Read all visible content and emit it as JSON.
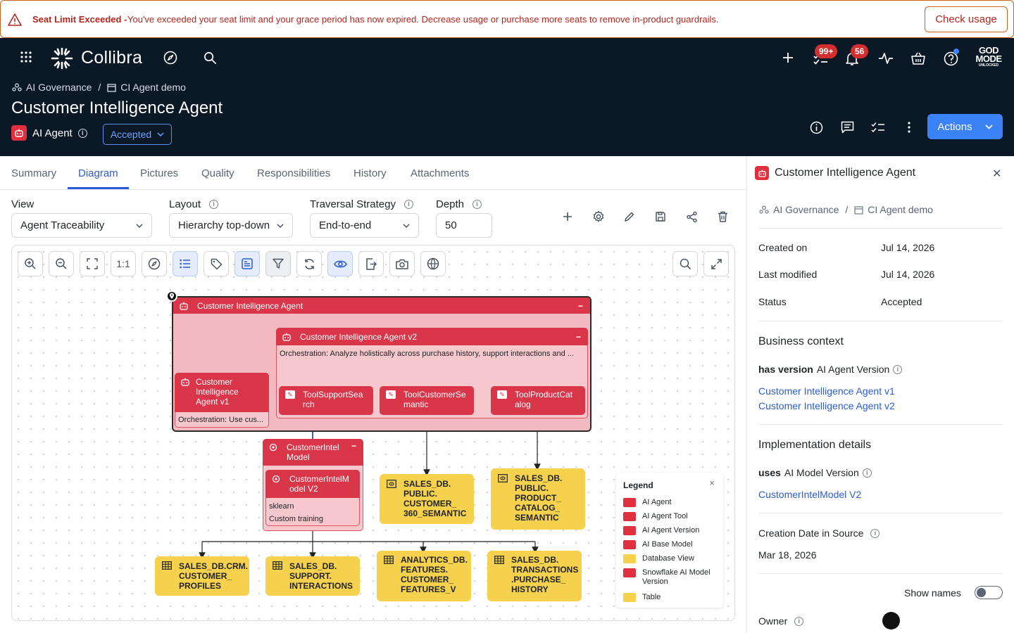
{
  "banner": {
    "title": "Seat Limit Exceeded -",
    "message": "You've exceeded your seat limit and your grace period has now expired. Decrease usage or purchase more seats to remove in-product guardrails.",
    "button": "Check usage"
  },
  "header": {
    "brand": "Collibra",
    "tasks_badge": "99+",
    "notifications_badge": "56",
    "godmode_line1": "GOD",
    "godmode_line2": "MODE",
    "godmode_line3": "UNLOCKED",
    "breadcrumb": [
      "AI Governance",
      "CI Agent demo"
    ],
    "breadcrumb_sep": "/",
    "title": "Customer Intelligence Agent",
    "asset_type": "AI Agent",
    "status": "Accepted",
    "actions": "Actions"
  },
  "tabs": [
    "Summary",
    "Diagram",
    "Pictures",
    "Quality",
    "Responsibilities",
    "History",
    "Attachments"
  ],
  "controls": {
    "view_label": "View",
    "view_value": "Agent Traceability",
    "layout_label": "Layout",
    "layout_value": "Hierarchy top-down",
    "traversal_label": "Traversal Strategy",
    "traversal_value": "End-to-end",
    "depth_label": "Depth",
    "depth_value": "50"
  },
  "canvas": {
    "one_to_one": "1:1"
  },
  "diagram": {
    "outer_title": "Customer Intelligence Agent",
    "v2_title": "Customer Intelligence Agent v2",
    "v2_desc": "Orchestration: Analyze holistically across purchase history, support interactions and ...",
    "v1_line1": "Customer",
    "v1_line2": "Intelligence",
    "v1_line3": "Agent v1",
    "v1_desc": "Orchestration: Use cus...",
    "tool1_a": "ToolSupportSea",
    "tool1_b": "rch",
    "tool2_a": "ToolCustomerSe",
    "tool2_b": "mantic",
    "tool3_a": "ToolProductCat",
    "tool3_b": "alog",
    "model_a": "CustomerIntel",
    "model_b": "Model",
    "modelv2_a": "CustomerIntelM",
    "modelv2_b": "odel V2",
    "model_attr1": "sklearn",
    "model_attr2": "Custom training",
    "view1": [
      "SALES_DB.",
      "PUBLIC.",
      "CUSTOMER_",
      "360_SEMANTIC"
    ],
    "view2": [
      "SALES_DB.",
      "PUBLIC.",
      "PRODUCT_",
      "CATALOG_",
      "SEMANTIC"
    ],
    "table1": [
      "SALES_DB.CRM.",
      "CUSTOMER_",
      "PROFILES"
    ],
    "table2": [
      "SALES_DB.",
      "SUPPORT.",
      "INTERACTIONS"
    ],
    "table3": [
      "ANALYTICS_DB.",
      "FEATURES.",
      "CUSTOMER_",
      "FEATURES_V"
    ],
    "table4": [
      "SALES_DB.",
      "TRANSACTIONS",
      ".PURCHASE_",
      "HISTORY"
    ]
  },
  "legend": {
    "title": "Legend",
    "close": "×",
    "items": [
      {
        "label": "AI Agent",
        "color": "#e0303f"
      },
      {
        "label": "AI Agent Tool",
        "color": "#e0303f"
      },
      {
        "label": "AI Agent Version",
        "color": "#e0303f"
      },
      {
        "label": "AI Base Model",
        "color": "#e0303f"
      },
      {
        "label": "Database View",
        "color": "#f6d14d"
      },
      {
        "label": "Snowflake AI Model",
        "label2": "Version",
        "color": "#e0303f"
      },
      {
        "label": "Table",
        "color": "#f6d14d"
      }
    ]
  },
  "panel": {
    "title": "Customer Intelligence Agent",
    "breadcrumb": [
      "AI Governance",
      "CI Agent demo"
    ],
    "breadcrumb_sep": "/",
    "created_on_label": "Created on",
    "created_on": "Jul 14, 2026",
    "last_modified_label": "Last modified",
    "last_modified": "Jul 14, 2026",
    "status_label": "Status",
    "status": "Accepted",
    "business_context": "Business context",
    "has_version_rel": "has version",
    "has_version_type": "AI Agent Version",
    "version_links": [
      "Customer Intelligence Agent v1",
      "Customer Intelligence Agent v2"
    ],
    "implementation": "Implementation details",
    "uses_rel": "uses",
    "uses_type": "AI Model Version",
    "model_link": "CustomerIntelModel V2",
    "creation_date_label": "Creation Date in Source",
    "creation_date": "Mar 18, 2026",
    "show_names": "Show names",
    "owner_label": "Owner"
  },
  "colors": {
    "header_bg": "#0b1826",
    "accent": "#3b82f6",
    "agent_red": "#e0303f",
    "table_yellow": "#f6d14d",
    "warning": "#b3261e"
  }
}
